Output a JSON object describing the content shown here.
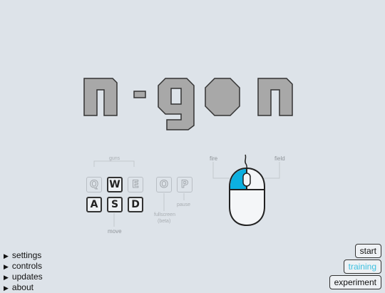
{
  "logo": {
    "text": "n-gon"
  },
  "keys": {
    "row1": [
      {
        "key": "Q",
        "active": false
      },
      {
        "key": "W",
        "active": true
      },
      {
        "key": "E",
        "active": false
      },
      {
        "key": "O",
        "active": false
      },
      {
        "key": "P",
        "active": false
      }
    ],
    "row2": [
      {
        "key": "A",
        "active": true
      },
      {
        "key": "S",
        "active": true
      },
      {
        "key": "D",
        "active": true
      }
    ]
  },
  "hints": {
    "guns": "guns",
    "move": "move",
    "fullscreen": "fullscreen",
    "beta": "(beta)",
    "pause": "pause"
  },
  "mouse": {
    "fire": "fire",
    "field": "field"
  },
  "menu": [
    {
      "label": "settings"
    },
    {
      "label": "controls"
    },
    {
      "label": "updates"
    },
    {
      "label": "about"
    }
  ],
  "buttons": {
    "start": "start",
    "training": "training",
    "experiment": "experiment"
  },
  "colors": {
    "background": "#dde3e9",
    "logo_fill": "#a8a8a8",
    "mouse_button": "#0cb0e0",
    "training_text": "#3cc0e0"
  }
}
